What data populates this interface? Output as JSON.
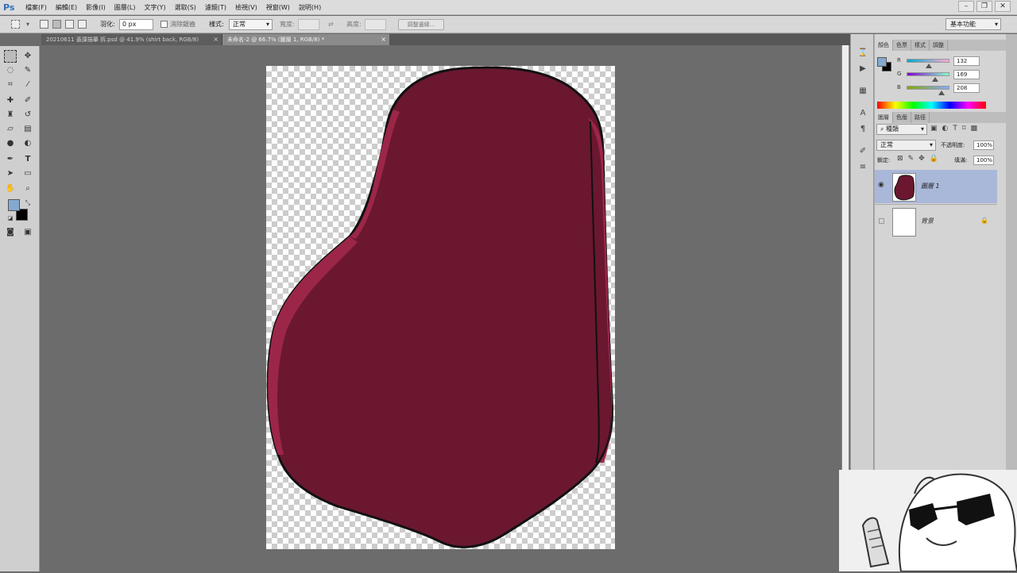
{
  "app": {
    "logo": "Ps"
  },
  "menu": [
    "檔案(F)",
    "編輯(E)",
    "影像(I)",
    "圖層(L)",
    "文字(Y)",
    "選取(S)",
    "濾鏡(T)",
    "檢視(V)",
    "視窗(W)",
    "說明(H)"
  ],
  "window_controls": {
    "minimize": "–",
    "restore": "❐",
    "close": "✕"
  },
  "options": {
    "feather_label": "羽化:",
    "feather_value": "0 px",
    "antialias_label": "消除鋸齒",
    "style_label": "樣式:",
    "style_value": "正常",
    "width_label": "寬度:",
    "height_label": "高度:",
    "refine_edge": "調整邊緣...",
    "workspace": "基本功能"
  },
  "tabs": [
    {
      "title": "20210611 蓋課描摹 拆.psd @ 41.9% (shirt back, RGB/8)",
      "close": "×"
    },
    {
      "title": "未命名-2 @ 66.7% (圖層 1, RGB/8) *",
      "close": "×"
    }
  ],
  "colors": {
    "foreground": "#84a9d0",
    "background": "#000000",
    "shape_fill": "#6b1730",
    "shape_highlight": "#9c2648"
  },
  "color_panel": {
    "tabs": [
      "顏色",
      "色票",
      "樣式",
      "調整"
    ],
    "r_label": "R",
    "r_value": "132",
    "g_label": "G",
    "g_value": "169",
    "b_label": "B",
    "b_value": "208"
  },
  "layers_panel": {
    "tabs": [
      "圖層",
      "色版",
      "路徑"
    ],
    "filter": "種類",
    "blend_mode": "正常",
    "opacity_label": "不透明度:",
    "opacity_value": "100%",
    "lock_label": "鎖定:",
    "fill_label": "填滿:",
    "fill_value": "100%",
    "layers": [
      {
        "name": "圖層 1",
        "selected": true
      },
      {
        "name": "背景",
        "selected": false
      }
    ]
  }
}
